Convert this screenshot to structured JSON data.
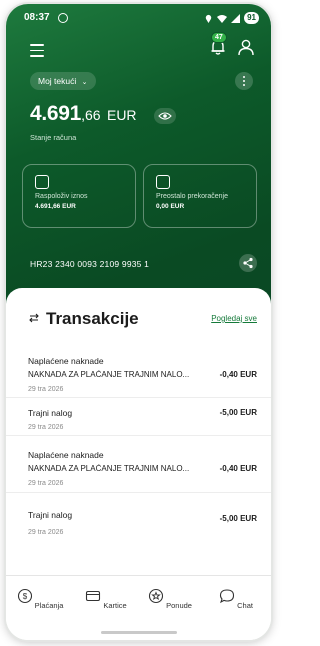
{
  "status_bar": {
    "time": "08:37",
    "battery": "91"
  },
  "header": {
    "notification_count": "47"
  },
  "account": {
    "selector_label": "Moj tekući",
    "balance_int": "4.691",
    "balance_frac": ",66",
    "currency": "EUR",
    "balance_label": "Stanje računa",
    "iban": "HR23 2340 0093 2109 9935 1"
  },
  "cards": [
    {
      "label": "Raspoloživ iznos",
      "value": "4.691,66 EUR"
    },
    {
      "label": "Preostalo prekoračenje",
      "value": "0,00 EUR"
    }
  ],
  "transactions": {
    "title": "Transakcije",
    "view_all": "Pogledaj sve",
    "items": [
      {
        "title": "Naplaćene naknade",
        "desc": "NAKNADA ZA PLAĆANJE TRAJNIM NALO...",
        "amount": "-0,40 EUR",
        "date": "29 tra 2026"
      },
      {
        "title": "Trajni nalog",
        "desc": "",
        "amount": "-5,00 EUR",
        "date": "29 tra 2026"
      },
      {
        "title": "Naplaćene naknade",
        "desc": "NAKNADA ZA PLAĆANJE TRAJNIM NALO...",
        "amount": "-0,40 EUR",
        "date": "29 tra 2026"
      },
      {
        "title": "Trajni nalog",
        "desc": "",
        "amount": "-5,00 EUR",
        "date": "29 tra 2026"
      }
    ]
  },
  "nav": [
    {
      "label": "Plaćanja",
      "icon": "payments-icon"
    },
    {
      "label": "Kartice",
      "icon": "card-icon"
    },
    {
      "label": "Ponude",
      "icon": "offers-icon"
    },
    {
      "label": "Chat",
      "icon": "chat-icon"
    }
  ],
  "colors": {
    "brand_green": "#0d5a2a",
    "accent_green": "#157a3a",
    "badge_green": "#33b249"
  }
}
